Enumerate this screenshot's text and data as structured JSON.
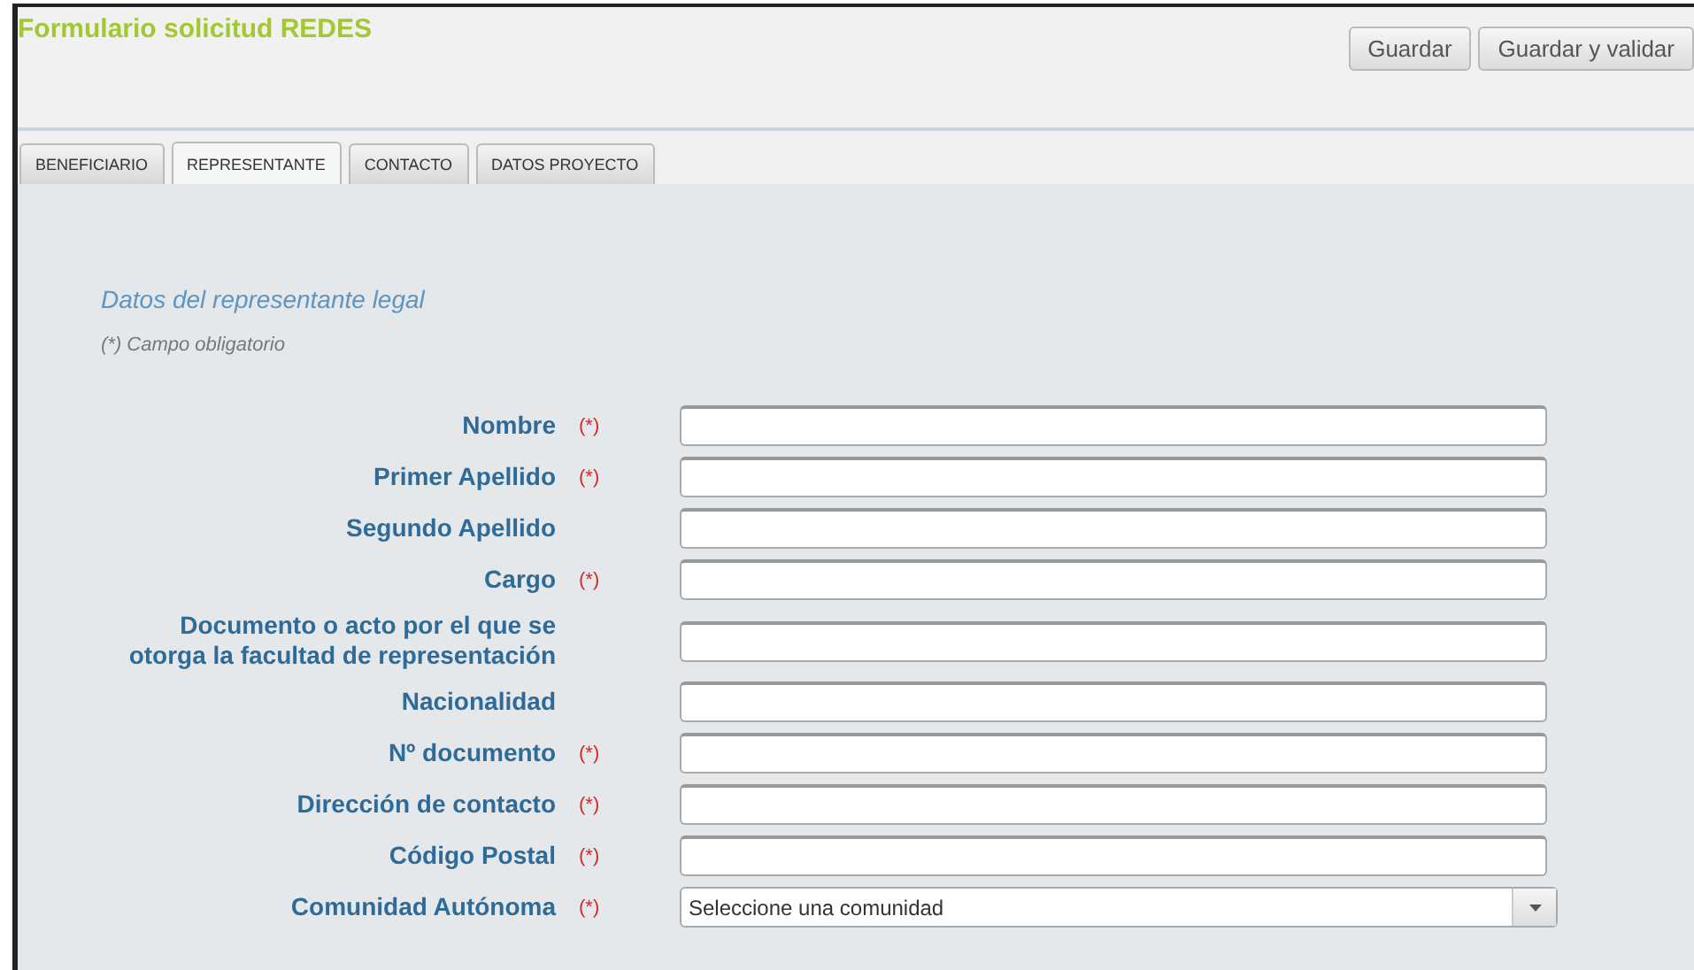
{
  "header": {
    "title": "Formulario solicitud REDES",
    "buttons": [
      "Guardar",
      "Guardar y validar"
    ]
  },
  "tabs": [
    {
      "label": "BENEFICIARIO",
      "selected": false
    },
    {
      "label": "REPRESENTANTE",
      "selected": true
    },
    {
      "label": "CONTACTO",
      "selected": false
    },
    {
      "label": "DATOS PROYECTO",
      "selected": false
    }
  ],
  "section": {
    "heading": "Datos del representante legal",
    "note": "(*) Campo obligatorio"
  },
  "fields": [
    {
      "label": "Nombre",
      "required_mark": "(*)",
      "kind": "text"
    },
    {
      "label": "Primer Apellido",
      "required_mark": "(*)",
      "kind": "text"
    },
    {
      "label": "Segundo Apellido",
      "kind": "text"
    },
    {
      "label": "Cargo",
      "required_mark": "(*)",
      "kind": "text"
    },
    {
      "label": "Documento o acto por el que se otorga la facultad de representación",
      "kind": "text"
    },
    {
      "label": "Nacionalidad",
      "kind": "text"
    },
    {
      "label": "Nº documento",
      "required_mark": "(*)",
      "kind": "text"
    },
    {
      "label": "Dirección de contacto",
      "required_mark": "(*)",
      "kind": "text"
    },
    {
      "label": "Código Postal",
      "required_mark": "(*)",
      "kind": "text"
    },
    {
      "label": "Comunidad Autónoma",
      "required_mark": "(*)",
      "kind": "select",
      "value": "Seleccione una comunidad"
    }
  ]
}
